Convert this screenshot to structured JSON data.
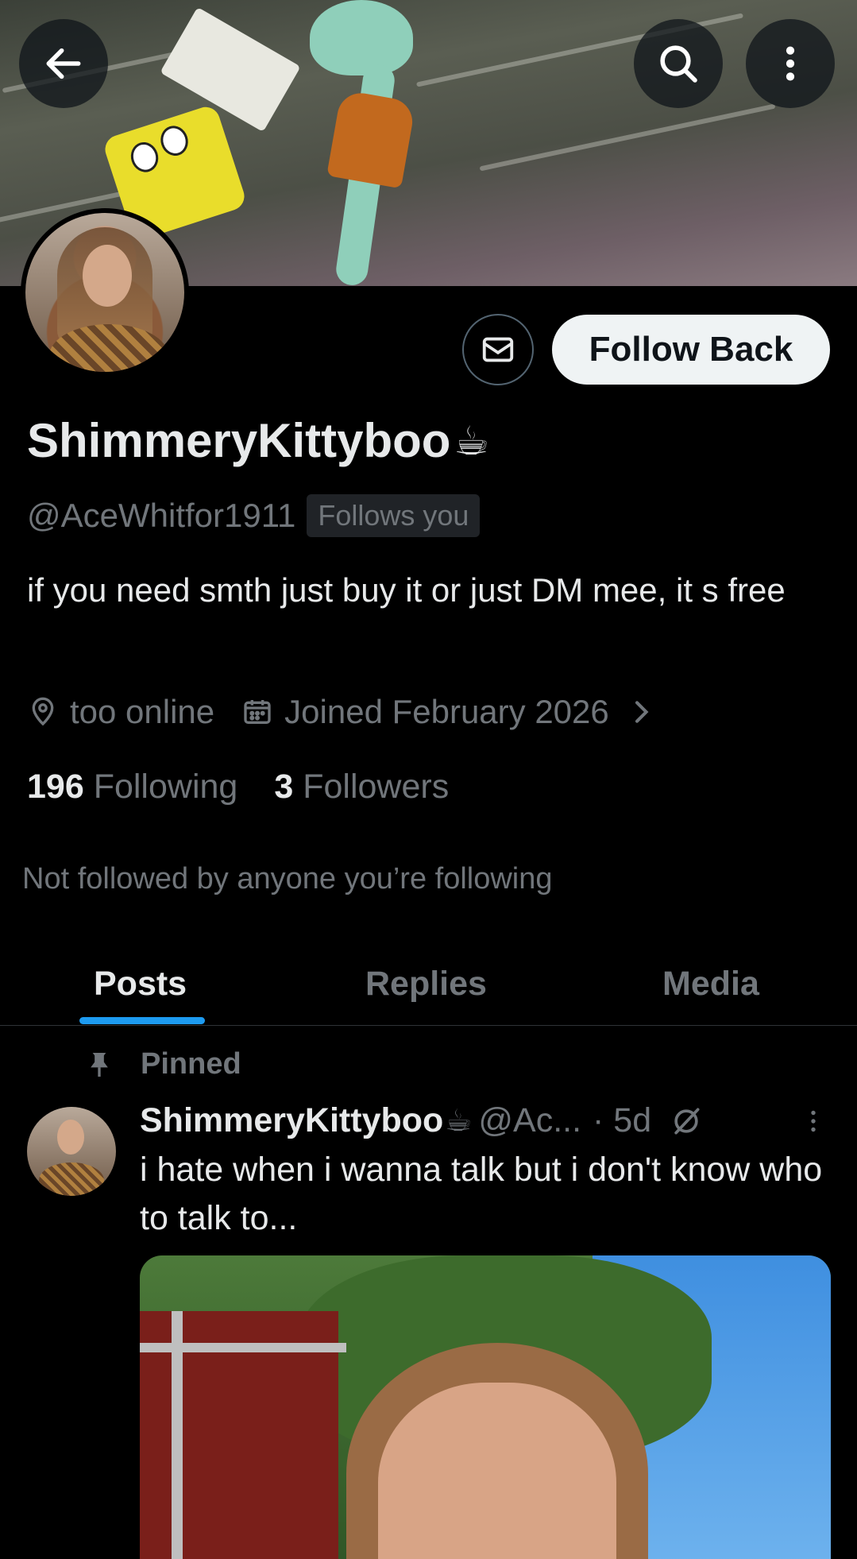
{
  "header": {
    "back_icon": "arrow-left-icon",
    "search_icon": "search-icon",
    "more_icon": "more-vertical-icon"
  },
  "profile": {
    "display_name": "ShimmeryKittyboo",
    "display_emoji": "☕",
    "handle": "@AceWhitfor1911",
    "follows_you_badge": "Follows you",
    "bio": "if you need smth just buy it or just DM mee, it s free",
    "location": "too online",
    "joined": "Joined February 2026",
    "following_count": "196",
    "following_label": "Following",
    "followers_count": "3",
    "followers_label": "Followers",
    "mutuals_text": "Not followed by anyone you’re following"
  },
  "actions": {
    "message_icon": "envelope-icon",
    "follow_label": "Follow Back"
  },
  "tabs": [
    {
      "label": "Posts",
      "active": true
    },
    {
      "label": "Replies",
      "active": false
    },
    {
      "label": "Media",
      "active": false
    }
  ],
  "pinned_post": {
    "pinned_label": "Pinned",
    "author_name": "ShimmeryKittyboo",
    "author_emoji": "☕",
    "author_handle": "@Ac...",
    "time": "· 5d",
    "text": "i hate when i wanna talk but i don't know who to talk to..."
  },
  "colors": {
    "background": "#000000",
    "accent": "#1d9bf0",
    "secondary_text": "#71767b",
    "primary_text": "#e7e9ea"
  }
}
